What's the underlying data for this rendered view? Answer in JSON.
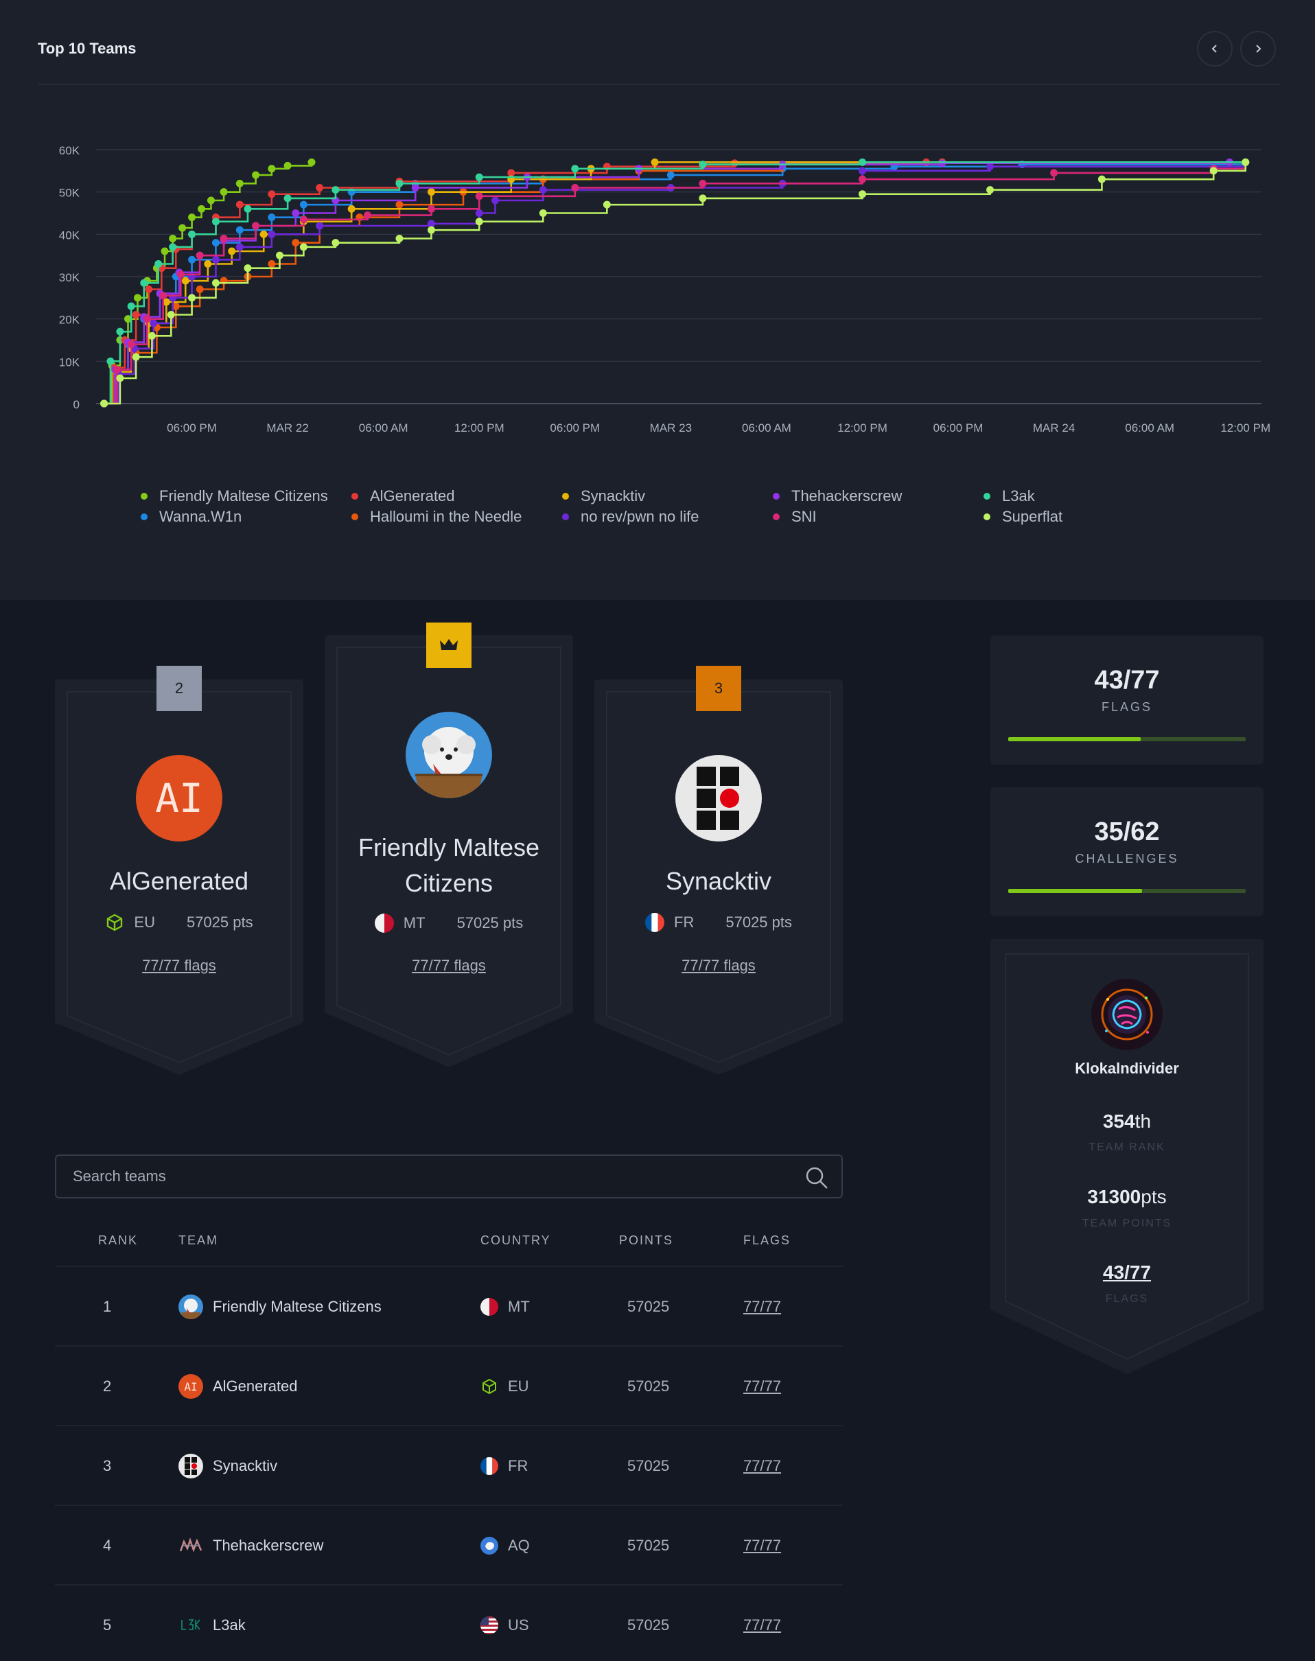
{
  "header": {
    "title": "Top 10 Teams",
    "prev_icon": "chevron-left-icon",
    "next_icon": "chevron-right-icon"
  },
  "chart_data": {
    "type": "line",
    "title": "",
    "y_ticks": [
      "0",
      "10K",
      "20K",
      "30K",
      "40K",
      "50K",
      "60K"
    ],
    "ylim": [
      0,
      60000
    ],
    "x_ticks": [
      "06:00 PM",
      "MAR 22",
      "06:00 AM",
      "12:00 PM",
      "06:00 PM",
      "MAR 23",
      "06:00 AM",
      "12:00 PM",
      "06:00 PM",
      "MAR 24",
      "06:00 AM",
      "12:00 PM"
    ],
    "x_unit": "hours since MAR 21 00:00",
    "xlim": [
      12,
      85
    ],
    "grid": true,
    "legend_position": "bottom",
    "series": [
      {
        "name": "Friendly Maltese Citizens",
        "color": "#84cc16",
        "points": [
          [
            12.5,
            0
          ],
          [
            13,
            9000
          ],
          [
            13.5,
            15000
          ],
          [
            14,
            20000
          ],
          [
            14.6,
            25000
          ],
          [
            15.2,
            29000
          ],
          [
            15.8,
            32000
          ],
          [
            16.3,
            36000
          ],
          [
            16.8,
            39000
          ],
          [
            17.4,
            41500
          ],
          [
            18,
            44000
          ],
          [
            18.6,
            46000
          ],
          [
            19.2,
            48000
          ],
          [
            20,
            50000
          ],
          [
            21,
            52000
          ],
          [
            22,
            54000
          ],
          [
            23,
            55500
          ],
          [
            24,
            56200
          ],
          [
            25.5,
            57025
          ]
        ]
      },
      {
        "name": "Wanna.W1n",
        "color": "#1e88e5",
        "points": [
          [
            12.5,
            0
          ],
          [
            13.2,
            8000
          ],
          [
            14,
            14000
          ],
          [
            15,
            20000
          ],
          [
            16,
            26000
          ],
          [
            17,
            30000
          ],
          [
            18,
            34000
          ],
          [
            19.5,
            38000
          ],
          [
            21,
            41000
          ],
          [
            23,
            44000
          ],
          [
            25,
            47000
          ],
          [
            28,
            50000
          ],
          [
            32,
            52000
          ],
          [
            40,
            53000
          ],
          [
            48,
            54000
          ],
          [
            55,
            55500
          ],
          [
            62,
            56000
          ],
          [
            70,
            56500
          ],
          [
            84,
            57025
          ]
        ]
      },
      {
        "name": "AlGenerated",
        "color": "#e53935",
        "points": [
          [
            12.5,
            0
          ],
          [
            13.1,
            8500
          ],
          [
            13.8,
            15000
          ],
          [
            14.5,
            21000
          ],
          [
            15.3,
            27000
          ],
          [
            16.1,
            32000
          ],
          [
            17,
            36500
          ],
          [
            18,
            40000
          ],
          [
            19.5,
            44000
          ],
          [
            21,
            47000
          ],
          [
            23,
            49500
          ],
          [
            26,
            51000
          ],
          [
            31,
            52500
          ],
          [
            38,
            54500
          ],
          [
            44,
            56000
          ],
          [
            52,
            56800
          ],
          [
            64,
            57025
          ],
          [
            84,
            57025
          ]
        ]
      },
      {
        "name": "Halloumi in the Needle",
        "color": "#ea580c",
        "points": [
          [
            12.5,
            0
          ],
          [
            13.4,
            7000
          ],
          [
            14.5,
            12000
          ],
          [
            15.8,
            18000
          ],
          [
            17,
            23000
          ],
          [
            18.5,
            27000
          ],
          [
            20,
            29000
          ],
          [
            21.5,
            30000
          ],
          [
            23,
            33000
          ],
          [
            24.5,
            38000
          ],
          [
            26,
            42000
          ],
          [
            28.5,
            44000
          ],
          [
            31,
            47000
          ],
          [
            35,
            50000
          ],
          [
            40,
            53000
          ],
          [
            46,
            55000
          ],
          [
            55,
            56500
          ],
          [
            65,
            57025
          ],
          [
            84,
            57025
          ]
        ]
      },
      {
        "name": "Synacktiv",
        "color": "#eab308",
        "points": [
          [
            12.5,
            0
          ],
          [
            13.3,
            7500
          ],
          [
            14.2,
            13000
          ],
          [
            15.3,
            19000
          ],
          [
            16.4,
            24000
          ],
          [
            17.6,
            29000
          ],
          [
            19,
            33000
          ],
          [
            20.5,
            36000
          ],
          [
            22.5,
            40000
          ],
          [
            25,
            43000
          ],
          [
            28,
            46000
          ],
          [
            33,
            50000
          ],
          [
            38,
            53000
          ],
          [
            43,
            55500
          ],
          [
            47,
            57025
          ],
          [
            84,
            57025
          ]
        ]
      },
      {
        "name": "no rev/pwn no life",
        "color": "#6d28d9",
        "points": [
          [
            12.5,
            0
          ],
          [
            13.4,
            7000
          ],
          [
            14.4,
            13000
          ],
          [
            15.6,
            19000
          ],
          [
            16.8,
            25000
          ],
          [
            18,
            30000
          ],
          [
            19.5,
            34000
          ],
          [
            21,
            37000
          ],
          [
            23,
            40000
          ],
          [
            26,
            42000
          ],
          [
            33,
            42500
          ],
          [
            36,
            45000
          ],
          [
            37,
            48000
          ],
          [
            40,
            50500
          ],
          [
            48,
            51000
          ],
          [
            55,
            52000
          ],
          [
            60,
            55000
          ],
          [
            68,
            56000
          ],
          [
            84,
            57025
          ]
        ]
      },
      {
        "name": "Thehackerscrew",
        "color": "#9333ea",
        "points": [
          [
            12.5,
            0
          ],
          [
            13.2,
            8000
          ],
          [
            14,
            14500
          ],
          [
            15,
            20500
          ],
          [
            16,
            26000
          ],
          [
            17.2,
            31000
          ],
          [
            18.5,
            35000
          ],
          [
            20,
            38500
          ],
          [
            22,
            42000
          ],
          [
            24.5,
            45000
          ],
          [
            27,
            48000
          ],
          [
            32,
            51000
          ],
          [
            39,
            53500
          ],
          [
            46,
            55500
          ],
          [
            55,
            56500
          ],
          [
            65,
            56800
          ],
          [
            83,
            57025
          ]
        ]
      },
      {
        "name": "SNI",
        "color": "#db2777",
        "points": [
          [
            12.5,
            0
          ],
          [
            13.3,
            8000
          ],
          [
            14.2,
            14000
          ],
          [
            15.2,
            20000
          ],
          [
            16.2,
            25500
          ],
          [
            17.3,
            30500
          ],
          [
            18.5,
            35000
          ],
          [
            20,
            39000
          ],
          [
            22,
            42000
          ],
          [
            25,
            43500
          ],
          [
            29,
            44500
          ],
          [
            33,
            46000
          ],
          [
            36,
            49000
          ],
          [
            42,
            51000
          ],
          [
            50,
            52000
          ],
          [
            60,
            53000
          ],
          [
            72,
            54500
          ],
          [
            82,
            55500
          ],
          [
            84,
            57025
          ]
        ]
      },
      {
        "name": "L3ak",
        "color": "#34d399",
        "points": [
          [
            12.5,
            0
          ],
          [
            12.9,
            10000
          ],
          [
            13.5,
            17000
          ],
          [
            14.2,
            23000
          ],
          [
            15,
            28500
          ],
          [
            15.9,
            33000
          ],
          [
            16.8,
            37000
          ],
          [
            18,
            40000
          ],
          [
            19.5,
            43000
          ],
          [
            21.5,
            46000
          ],
          [
            24,
            48500
          ],
          [
            27,
            50500
          ],
          [
            31,
            52000
          ],
          [
            36,
            53500
          ],
          [
            42,
            55500
          ],
          [
            50,
            56500
          ],
          [
            60,
            57025
          ],
          [
            84,
            57025
          ]
        ]
      },
      {
        "name": "Superflat",
        "color": "#bef264",
        "points": [
          [
            12.5,
            0
          ],
          [
            13.5,
            6000
          ],
          [
            14.5,
            11000
          ],
          [
            15.5,
            16000
          ],
          [
            16.7,
            21000
          ],
          [
            18,
            25000
          ],
          [
            19.5,
            28500
          ],
          [
            21.5,
            32000
          ],
          [
            23.5,
            35000
          ],
          [
            25,
            37000
          ],
          [
            27,
            38000
          ],
          [
            31,
            39000
          ],
          [
            33,
            41000
          ],
          [
            36,
            43000
          ],
          [
            40,
            45000
          ],
          [
            44,
            47000
          ],
          [
            50,
            48500
          ],
          [
            60,
            49500
          ],
          [
            68,
            50500
          ],
          [
            75,
            53000
          ],
          [
            82,
            55000
          ],
          [
            84,
            57025
          ]
        ]
      }
    ]
  },
  "podium": [
    {
      "rank": "2",
      "name": "AlGenerated",
      "country": "EU",
      "points": "57025 pts",
      "flags": "77/77 flags",
      "avatar_text": "AI",
      "avatar_color": "#e04e1f",
      "badge_color": "#8f97a8"
    },
    {
      "rank": "1",
      "name": "Friendly Maltese Citizens",
      "country": "MT",
      "points": "57025 pts",
      "flags": "77/77 flags",
      "badge_icon": "crown-icon",
      "badge_color": "#eab308"
    },
    {
      "rank": "3",
      "name": "Synacktiv",
      "country": "FR",
      "points": "57025 pts",
      "flags": "77/77 flags",
      "badge_color": "#d97706"
    }
  ],
  "stats": {
    "flags": {
      "value": "43/77",
      "label": "FLAGS",
      "progress": 0.558
    },
    "challenges": {
      "value": "35/62",
      "label": "CHALLENGES",
      "progress": 0.565
    }
  },
  "user": {
    "name": "Klokalndivider",
    "rank_value": "354",
    "rank_suffix": "th",
    "rank_label": "TEAM RANK",
    "points_value": "31300",
    "points_suffix": "pts",
    "points_label": "TEAM POINTS",
    "flags_value": "43/77",
    "flags_label": "FLAGS"
  },
  "search": {
    "placeholder": "Search teams",
    "icon": "search-icon"
  },
  "table": {
    "headers": {
      "rank": "RANK",
      "team": "TEAM",
      "country": "COUNTRY",
      "points": "POINTS",
      "flags": "FLAGS"
    },
    "rows": [
      {
        "rank": "1",
        "team": "Friendly Maltese Citizens",
        "country": "MT",
        "points": "57025",
        "flags": "77/77"
      },
      {
        "rank": "2",
        "team": "AlGenerated",
        "country": "EU",
        "points": "57025",
        "flags": "77/77"
      },
      {
        "rank": "3",
        "team": "Synacktiv",
        "country": "FR",
        "points": "57025",
        "flags": "77/77"
      },
      {
        "rank": "4",
        "team": "Thehackerscrew",
        "country": "AQ",
        "points": "57025",
        "flags": "77/77"
      },
      {
        "rank": "5",
        "team": "L3ak",
        "country": "US",
        "points": "57025",
        "flags": "77/77"
      }
    ]
  }
}
